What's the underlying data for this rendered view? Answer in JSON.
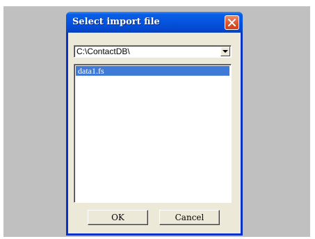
{
  "dialog": {
    "title": "Select import file",
    "close_icon": "close-icon"
  },
  "folder_combo": {
    "value": "C:\\ContactDB\\",
    "dropdown_icon": "chevron-down-icon"
  },
  "file_list": {
    "items": [
      {
        "label": "data1.fs",
        "selected": true
      }
    ]
  },
  "buttons": {
    "ok_label": "OK",
    "cancel_label": "Cancel"
  },
  "colors": {
    "titlebar": "#0653dd",
    "selection": "#3f7ad6",
    "face": "#ece9d8",
    "close": "#e0542c"
  }
}
